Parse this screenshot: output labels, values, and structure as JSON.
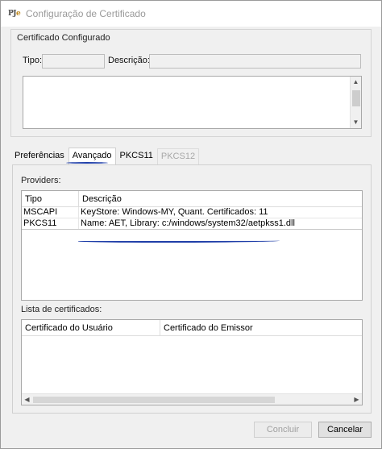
{
  "window": {
    "title": "Configuração de Certificado",
    "logo_text": "PJ",
    "logo_accent": "e"
  },
  "certificado_configurado": {
    "legend": "Certificado Configurado",
    "tipo_label": "Tipo:",
    "tipo_value": "",
    "descricao_label": "Descrição:",
    "descricao_value": "",
    "details_text": ""
  },
  "tabs": [
    {
      "label": "Preferências",
      "state": "normal"
    },
    {
      "label": "Avançado",
      "state": "active"
    },
    {
      "label": "PKCS11",
      "state": "normal"
    },
    {
      "label": "PKCS12",
      "state": "disabled"
    }
  ],
  "providers": {
    "legend": "Providers:",
    "columns": [
      "Tipo",
      "Descrição"
    ],
    "rows": [
      {
        "tipo": "MSCAPI",
        "descricao": "KeyStore: Windows-MY, Quant. Certificados: 11"
      },
      {
        "tipo": "PKCS11",
        "descricao": "Name: AET, Library: c:/windows/system32/aetpkss1.dll"
      }
    ]
  },
  "lista": {
    "legend": "Lista de certificados:",
    "columns": [
      "Certificado do Usuário",
      "Certificado do Emissor"
    ]
  },
  "buttons": {
    "concluir": "Concluir",
    "cancelar": "Cancelar"
  },
  "colors": {
    "annotation_ink": "#1f3ea8",
    "logo_accent": "#c08a1e"
  }
}
